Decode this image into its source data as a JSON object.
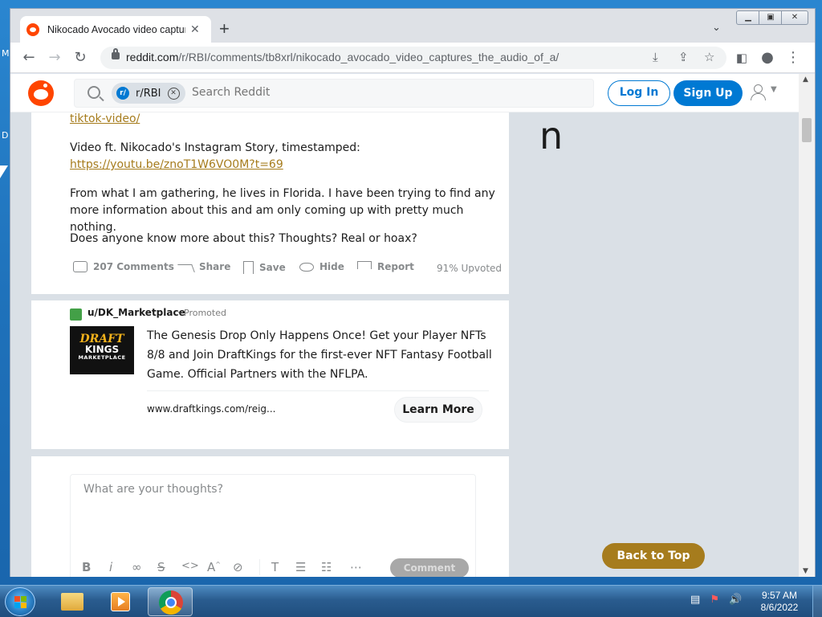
{
  "browser": {
    "tab_title": "Nikocado Avocado video captures",
    "tab_close": "✕",
    "new_tab": "+",
    "tab_search": "⌄",
    "url_host": "reddit.com",
    "url_path": "/r/RBI/comments/tb8xrl/nikocado_avocado_video_captures_the_audio_of_a/",
    "window_controls": {
      "minimize": "▁",
      "maximize": "▣",
      "close": "✕"
    }
  },
  "reddit_header": {
    "subreddit_chip": "r/RBI",
    "chip_icon": "r/",
    "search_placeholder": "Search Reddit",
    "login_label": "Log In",
    "signup_label": "Sign Up",
    "accent_color": "#0079d3"
  },
  "post": {
    "link1": "tiktok-video/",
    "para1": "Video ft. Nikocado's Instagram Story, timestamped:",
    "link2": "https://youtu.be/znoT1W6VO0M?t=69",
    "para2": "From what I am gathering, he lives in Florida. I have been trying to find any more information about this and am only coming up with pretty much nothing.",
    "para3": "Does anyone know more about this? Thoughts? Real or hoax?",
    "actions": {
      "comments": "207 Comments",
      "share": "Share",
      "save": "Save",
      "hide": "Hide",
      "report": "Report"
    },
    "upvoted": "91% Upvoted"
  },
  "promoted": {
    "user": "u/DK_Marketplace",
    "separator": "·",
    "tag": "Promoted",
    "logo_line1": "DRAFT",
    "logo_line2": "KINGS",
    "logo_line3": "MARKETPLACE",
    "text": "The Genesis Drop Only Happens Once! Get your Player NFTs 8/8 and Join DraftKings for the first-ever NFT Fantasy Football Game. Official Partners with the NFLPA.",
    "url": "www.draftkings.com/reig...",
    "cta": "Learn More"
  },
  "comment_box": {
    "placeholder": "What are your thoughts?",
    "submit_label": "Comment"
  },
  "sidebar_char": "n",
  "back_to_top": "Back to Top",
  "desktop": {
    "letters": [
      "M",
      "D"
    ]
  },
  "taskbar": {
    "time": "9:57 AM",
    "date": "8/6/2022"
  }
}
